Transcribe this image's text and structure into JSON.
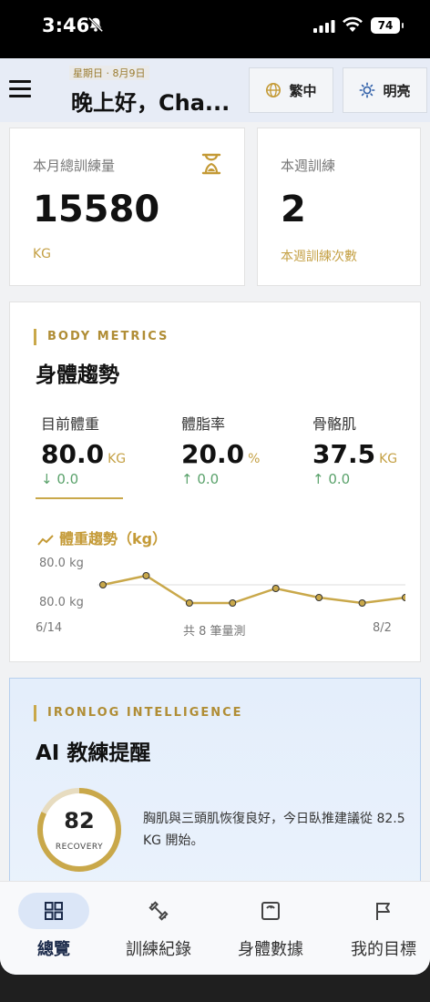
{
  "status_bar": {
    "time": "3:46",
    "battery": "74"
  },
  "header": {
    "date": "星期日 · 8月9日",
    "greeting": "晚上好，Cha...",
    "language_label": "繁中",
    "theme_label": "明亮"
  },
  "monthly_card": {
    "label": "本月總訓練量",
    "value": "15580",
    "unit": "KG"
  },
  "weekly_card": {
    "label": "本週訓練",
    "value": "2",
    "sub": "本週訓練次數"
  },
  "body_metrics": {
    "eyebrow": "BODY METRICS",
    "title": "身體趨勢",
    "metrics": [
      {
        "label": "目前體重",
        "value": "80.0",
        "unit": "KG",
        "delta": "↓ 0.0"
      },
      {
        "label": "體脂率",
        "value": "20.0",
        "unit": "%",
        "delta": "↑ 0.0"
      },
      {
        "label": "骨骼肌",
        "value": "37.5",
        "unit": "KG",
        "delta": "↑ 0.0"
      }
    ],
    "trend_title": "體重趨勢（kg）",
    "y_top_label": "80.0 kg",
    "y_bottom_label": "80.0 kg",
    "x_start": "6/14",
    "x_middle": "共 8 筆量測",
    "x_end": "8/2"
  },
  "chart_data": {
    "type": "line",
    "title": "體重趨勢（kg）",
    "x": [
      "6/14",
      "",
      "",
      "",
      "",
      "",
      "",
      "8/2"
    ],
    "series": [
      {
        "values": [
          80.0,
          80.05,
          79.9,
          79.9,
          79.98,
          79.93,
          79.9,
          79.93
        ]
      }
    ],
    "ylim": [
      79.85,
      80.1
    ],
    "grid": false
  },
  "ai_coach": {
    "eyebrow": "IRONLOG INTELLIGENCE",
    "title": "AI 教練提醒",
    "score": "82",
    "score_fraction": 0.82,
    "score_label": "RECOVERY",
    "message": "胸肌與三頭肌恢復良好，今日臥推建議從 82.5 KG 開始。"
  },
  "tabs": [
    {
      "label": "總覽",
      "icon": "grid-icon",
      "active": true
    },
    {
      "label": "訓練紀錄",
      "icon": "dumbbell-icon",
      "active": false
    },
    {
      "label": "身體數據",
      "icon": "scale-icon",
      "active": false
    },
    {
      "label": "我的目標",
      "icon": "flag-icon",
      "active": false
    }
  ],
  "colors": {
    "accent": "#c9a84a",
    "positive": "#5aa26b",
    "header_bg": "#e7ecf6"
  }
}
